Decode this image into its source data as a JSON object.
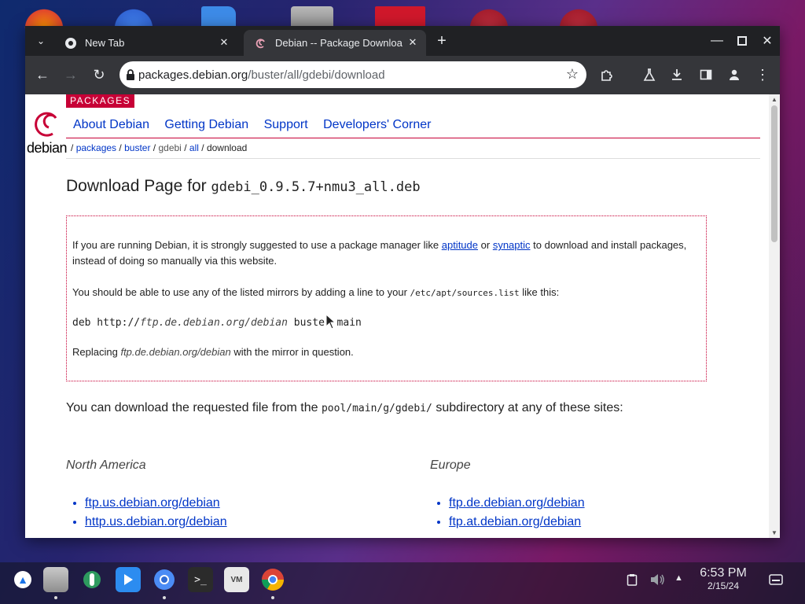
{
  "colors": {
    "debian_red": "#c70036",
    "link_blue": "#0035c7",
    "tab_bg": "#35363a",
    "frame_bg": "#202124"
  },
  "browser": {
    "tabs": [
      {
        "title": "New Tab",
        "icon": "chrome-icon",
        "active": false
      },
      {
        "title": "Debian -- Package Downloa",
        "icon": "debian-swirl-icon",
        "active": true
      }
    ],
    "url": {
      "host": "packages.debian.org",
      "path": "/buster/all/gdebi/download"
    },
    "window_controls": [
      "minimize-icon",
      "maximize-icon",
      "close-icon"
    ],
    "toolbar_icons": [
      "extensions-icon",
      "labs-icon",
      "download-icon",
      "side-panel-icon",
      "profile-icon",
      "menu-icon"
    ]
  },
  "page": {
    "section_tag": "PACKAGES",
    "logo_word": "debian",
    "nav": [
      "About Debian",
      "Getting Debian",
      "Support",
      "Developers' Corner"
    ],
    "breadcrumb": {
      "sep": "/",
      "packages": "packages",
      "buster": "buster",
      "gdebi": "gdebi",
      "all": "all",
      "current": "download"
    },
    "title_prefix": "Download Page for",
    "title_file": "gdebi_0.9.5.7+nmu3_all.deb",
    "notice": {
      "p1_a": "If you are running Debian, it is strongly suggested to use a package manager like",
      "aptitude": "aptitude",
      "or": "or",
      "synaptic": "synaptic",
      "p1_b": "to download and install packages, instead of doing so manually via this website.",
      "p2_a": "You should be able to use any of the listed mirrors by adding a line to your",
      "sources_file": "/etc/apt/sources.list",
      "p2_b": "like this:",
      "deb_prefix": "deb http://",
      "deb_mirror": "ftp.de.debian.org/debian",
      "deb_suffix": "buster main",
      "p3_a": "Replacing",
      "p3_mirror": "ftp.de.debian.org/debian",
      "p3_b": "with the mirror in question."
    },
    "download_a": "You can download the requested file from the",
    "download_dir": "pool/main/g/gdebi/",
    "download_b": "subdirectory at any of these sites:",
    "regions": [
      {
        "name": "North America",
        "mirrors": [
          "ftp.us.debian.org/debian",
          "http.us.debian.org/debian"
        ]
      },
      {
        "name": "Europe",
        "mirrors": [
          "ftp.de.debian.org/debian",
          "ftp.at.debian.org/debian"
        ]
      }
    ]
  },
  "taskbar": {
    "apps": [
      "files-icon",
      "settings-wrench-icon",
      "play-store-icon",
      "chromium-icon",
      "terminal-icon",
      "vmware-icon",
      "chrome-dev-icon"
    ],
    "time": "6:53 PM",
    "date": "2/15/24"
  }
}
